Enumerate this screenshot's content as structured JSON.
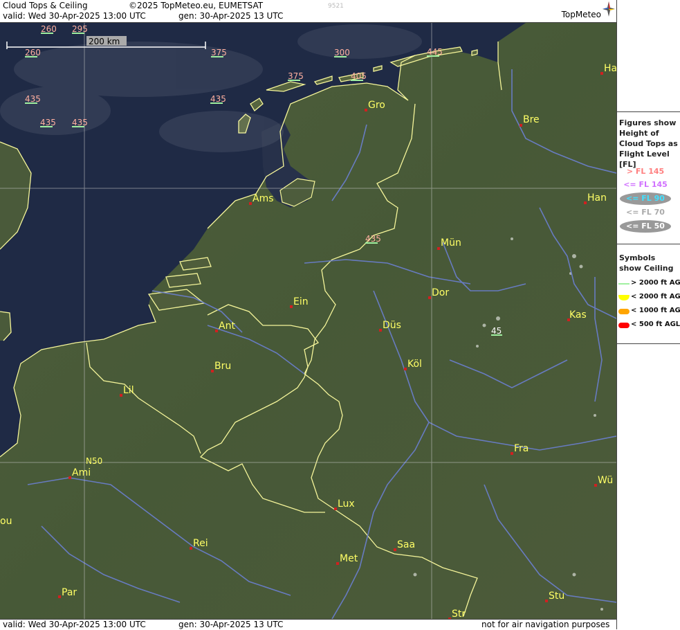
{
  "header": {
    "title": "Cloud Tops & Ceiling",
    "copyright": "©2025 TopMeteo.eu, EUMETSAT",
    "code": "9521",
    "valid": "valid:  Wed   30-Apr-2025   13:00 UTC",
    "gen": "gen: 30-Apr-2025 13 UTC",
    "logo": "TopMeteo"
  },
  "footer": {
    "valid": "valid:  Wed   30-Apr-2025   13:00 UTC",
    "gen": "gen: 30-Apr-2025 13 UTC",
    "disclaimer": "not for air navigation purposes"
  },
  "scale_bar": {
    "label": "200 km"
  },
  "legend_heights": {
    "title": "Figures show Height of Cloud Tops as Flight Level  [FL]",
    "items": [
      {
        "label": "> FL 145",
        "color": "#ff7f7f",
        "oval": false
      },
      {
        "label": "<= FL 145",
        "color": "#d070ff",
        "oval": false
      },
      {
        "label": "<= FL 90",
        "color": "#40e0ff",
        "oval": true
      },
      {
        "label": "<= FL 70",
        "color": "#aaaaaa",
        "oval": false
      },
      {
        "label": "<= FL 50",
        "color": "#ffffff",
        "oval": true
      }
    ]
  },
  "legend_ceiling": {
    "title": "Symbols show Ceiling",
    "items": [
      {
        "label": "> 2000 ft AGL",
        "color": "#a0f0a0"
      },
      {
        "label": "< 2000 ft AGL",
        "color": "#ffff00"
      },
      {
        "label": "< 1000 ft AGL",
        "color": "#ffa500"
      },
      {
        "label": "< 500 ft AGL",
        "color": "#ff0000"
      }
    ]
  },
  "cities": [
    {
      "label": "Gro"
    },
    {
      "label": "Bre"
    },
    {
      "label": "Ams"
    },
    {
      "label": "Han"
    },
    {
      "label": "Mün"
    },
    {
      "label": "Dor"
    },
    {
      "label": "Ein"
    },
    {
      "label": "Ant"
    },
    {
      "label": "Düs"
    },
    {
      "label": "Kas"
    },
    {
      "label": "Bru"
    },
    {
      "label": "Köl"
    },
    {
      "label": "Lil"
    },
    {
      "label": "Fra"
    },
    {
      "label": "Ami"
    },
    {
      "label": "Wü"
    },
    {
      "label": "Lux"
    },
    {
      "label": "Rei"
    },
    {
      "label": "Saa"
    },
    {
      "label": "Met"
    },
    {
      "label": "Par"
    },
    {
      "label": "Stu"
    },
    {
      "label": "Str"
    },
    {
      "label": "Ha"
    },
    {
      "label": "ou"
    }
  ],
  "grid_label": "N50",
  "flight_levels": [
    {
      "label": "260"
    },
    {
      "label": "295"
    },
    {
      "label": "260"
    },
    {
      "label": "375"
    },
    {
      "label": "300"
    },
    {
      "label": "445"
    },
    {
      "label": "375"
    },
    {
      "label": "405"
    },
    {
      "label": "435"
    },
    {
      "label": "435"
    },
    {
      "label": "435"
    },
    {
      "label": "435"
    },
    {
      "label": "435"
    },
    {
      "label": "45"
    }
  ]
}
